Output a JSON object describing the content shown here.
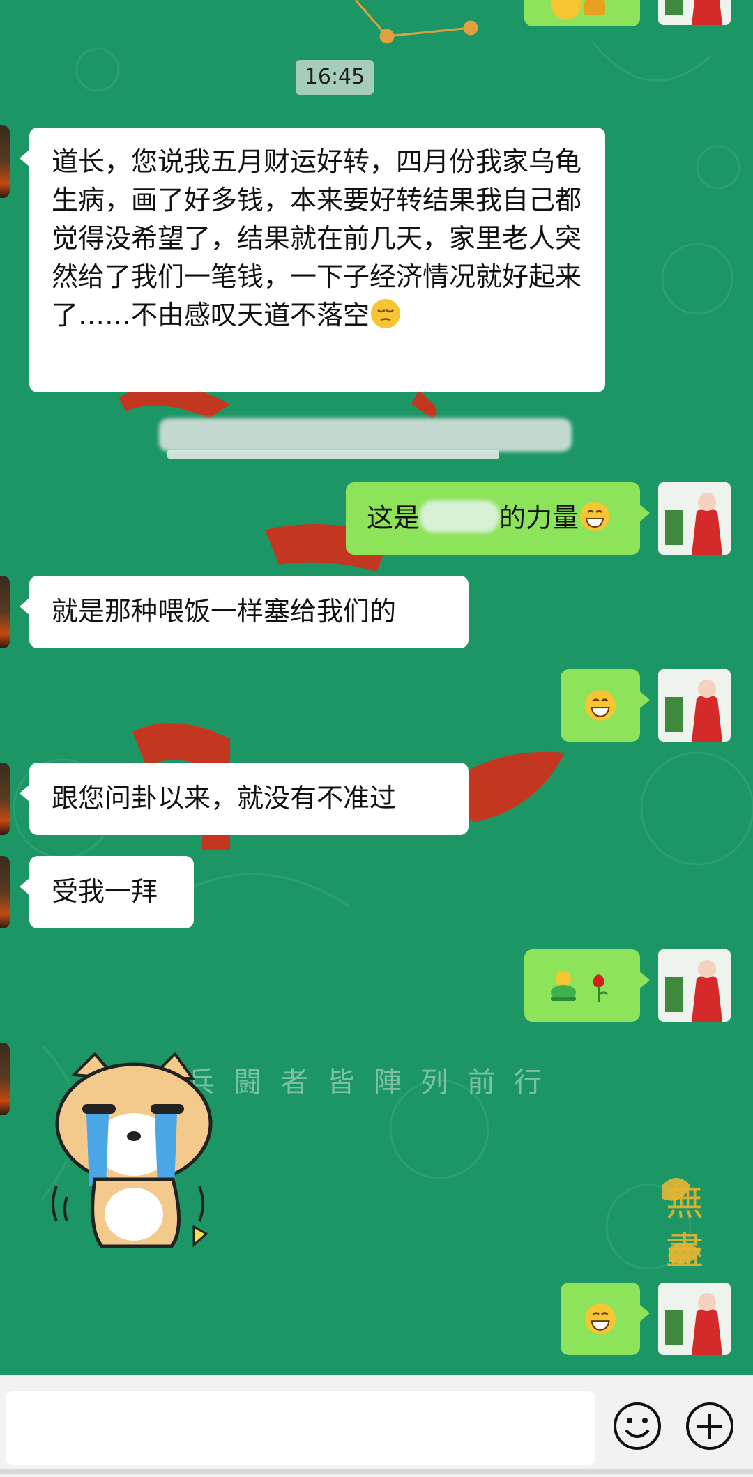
{
  "chat": {
    "timestamp": "16:45",
    "messages": [
      {
        "side": "left",
        "text": "道长，您说我五月财运好转，四月份我家乌龟生病，画了好多钱，本来要好转结果我自己都觉得没希望了，结果就在前几天，家里老人突然给了我们一笔钱，一下子经济情况就好起来了……不由感叹天道不落空"
      },
      {
        "side": "right",
        "text_before": "这是",
        "text_after": "的力量"
      },
      {
        "side": "left",
        "text": "就是那种喂饭一样塞给我们的"
      },
      {
        "side": "right",
        "emoji": "grinning-face"
      },
      {
        "side": "left",
        "text": "跟您问卦以来，就没有不准过"
      },
      {
        "side": "left",
        "text": "受我一拜"
      },
      {
        "side": "right",
        "emoji": "figure-and-rose"
      },
      {
        "side": "left",
        "sticker": "crying-shiba-dog"
      },
      {
        "side": "right",
        "emoji": "grinning-face"
      }
    ]
  },
  "background": {
    "watermark_text": "兵闘者皆陣列前行",
    "calligraphy_text": "無盡"
  },
  "input": {
    "placeholder": ""
  },
  "colors": {
    "background": "#1c9665",
    "right_bubble": "#8de45a",
    "left_bubble": "#ffffff"
  }
}
